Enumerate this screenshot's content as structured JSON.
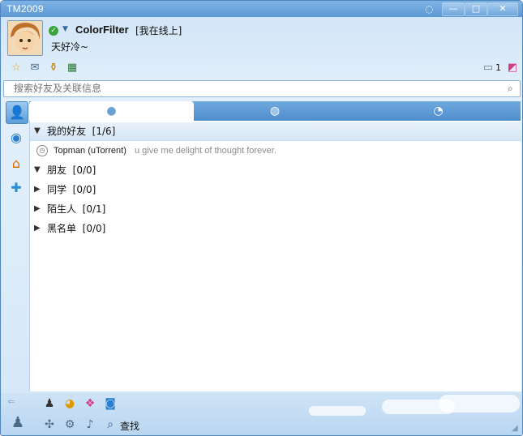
{
  "window": {
    "title": "TM2009",
    "buttons": {
      "minimize": "—",
      "maximize": "□",
      "close": "✕"
    }
  },
  "header": {
    "nickname": "ColorFilter",
    "status": "[我在线上]",
    "signature": "天好冷~",
    "message_count": "1"
  },
  "search": {
    "placeholder": "搜索好友及关联信息"
  },
  "groups": [
    {
      "name": "我的好友",
      "count": "[1/6]",
      "expanded": true
    },
    {
      "name": "朋友",
      "count": "[0/0]",
      "expanded": true
    },
    {
      "name": "同学",
      "count": "[0/0]",
      "expanded": false
    },
    {
      "name": "陌生人",
      "count": "[0/1]",
      "expanded": false
    },
    {
      "name": "黑名单",
      "count": "[0/0]",
      "expanded": false
    }
  ],
  "contact": {
    "name": "Topman (uTorrent)",
    "mood": "u give me delight of thought forever."
  },
  "bottom": {
    "find_label": "查找"
  },
  "colors": {
    "accent": "#5b98d4",
    "tab_bar": "#4f8ecd",
    "status_online": "#3aa33a"
  },
  "icons": {
    "toolbar": [
      "star-icon",
      "mail-icon",
      "wallet-icon",
      "note-icon"
    ],
    "sidebar": [
      "contacts-icon",
      "qzone-icon",
      "house-icon",
      "add-icon"
    ],
    "tabs": [
      "chat-bubble-icon",
      "group-chat-icon",
      "recent-icon"
    ],
    "bottom": [
      "qq-penguin-icon",
      "music-icon",
      "pet-icon",
      "browser-icon",
      "tools-icon",
      "settings-icon",
      "sound-icon",
      "find-icon"
    ]
  }
}
